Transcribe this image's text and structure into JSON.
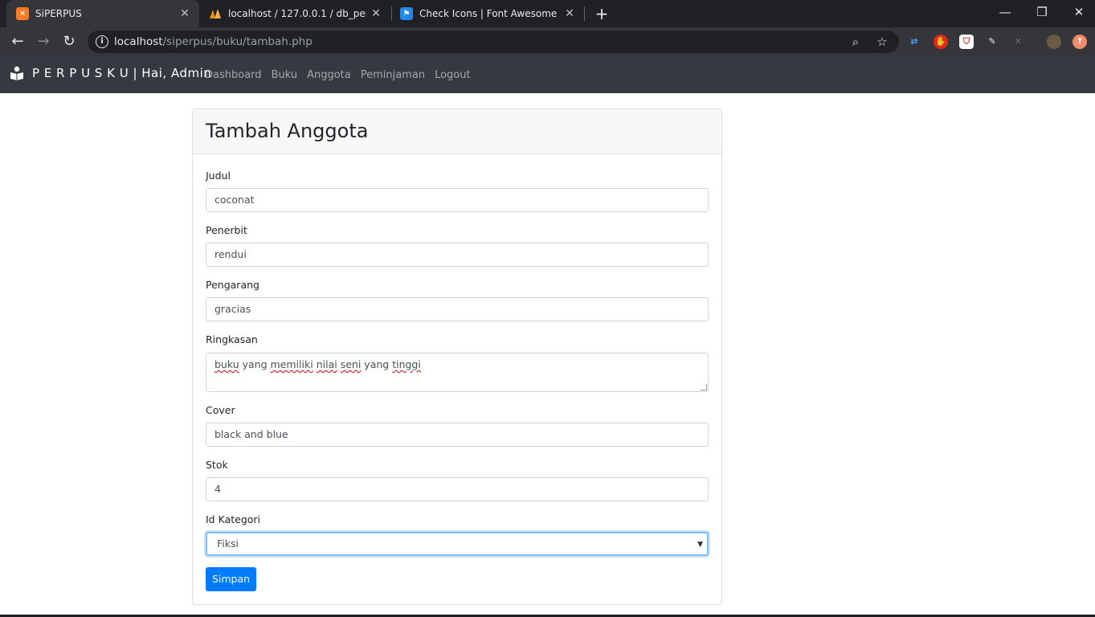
{
  "browser": {
    "tabs": [
      {
        "title": "SiPERPUS",
        "favicon": "xampp-icon"
      },
      {
        "title": "localhost / 127.0.0.1 / db_perpus",
        "favicon": "phpmyadmin-icon"
      },
      {
        "title": "Check Icons | Font Awesome",
        "favicon": "flag-icon"
      }
    ],
    "address": {
      "host": "localhost",
      "path": "/siperpus/buku/tambah.php"
    }
  },
  "site": {
    "brand": "P E R P U S K U | Hai, Admin",
    "nav": [
      "Dashboard",
      "Buku",
      "Anggota",
      "Peminjaman",
      "Logout"
    ]
  },
  "form": {
    "title": "Tambah Anggota",
    "fields": {
      "judul": {
        "label": "Judul",
        "value": "coconat"
      },
      "penerbit": {
        "label": "Penerbit",
        "value": "rendui"
      },
      "pengarang": {
        "label": "Pengarang",
        "value": "gracias"
      },
      "ringkasan": {
        "label": "Ringkasan",
        "value": "buku yang memiliki nilai seni yang tinggi"
      },
      "cover": {
        "label": "Cover",
        "value": "black and blue"
      },
      "stok": {
        "label": "Stok",
        "value": "4"
      },
      "kategori": {
        "label": "Id Kategori",
        "value": "Fiksi"
      }
    },
    "submit_label": "Simpan"
  },
  "colors": {
    "navbar": "#343a40",
    "primary": "#007bff",
    "focus": "#80bdff"
  }
}
